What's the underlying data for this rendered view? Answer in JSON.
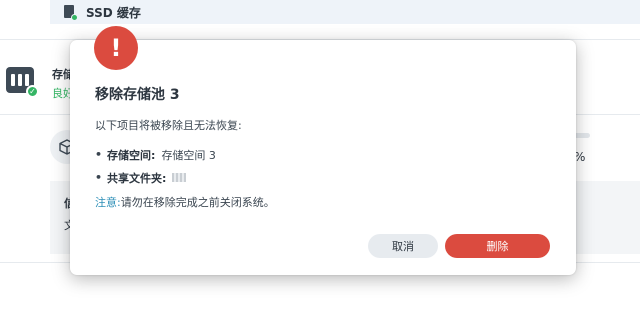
{
  "header": {
    "title": "SSD 缓存",
    "icon": "ssd-card-icon"
  },
  "pool_row": {
    "name": "存储",
    "status": "良好",
    "icon": "storage-pool-icon",
    "status_color": "#34b564"
  },
  "volume": {
    "usage_percent": "%"
  },
  "info_box": {
    "title": "信",
    "text": "文"
  },
  "dialog": {
    "alert_icon": "exclamation-icon",
    "alert_symbol": "!",
    "title": "移除存储池 3",
    "description": "以下项目将被移除且无法恢复:",
    "items": [
      {
        "bullet": "•",
        "label": "存储空间:",
        "value": "存储空间 3"
      },
      {
        "bullet": "•",
        "label": "共享文件夹:",
        "value": ""
      }
    ],
    "note_label": "注意:",
    "note_text": "请勿在移除完成之前关闭系统。",
    "cancel_label": "取消",
    "delete_label": "删除"
  },
  "colors": {
    "danger": "#db4b3f",
    "success": "#34b564",
    "note": "#2d8fb7"
  }
}
